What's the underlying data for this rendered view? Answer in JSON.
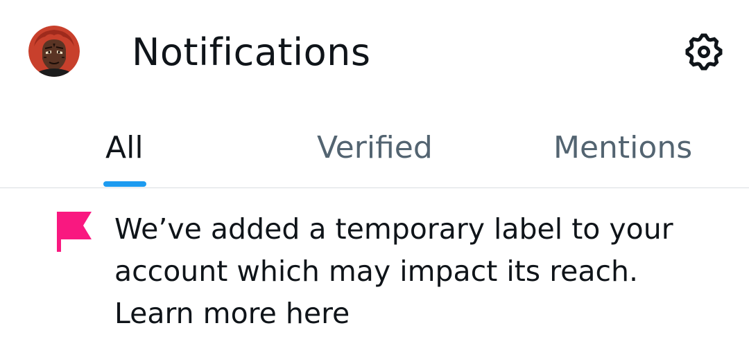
{
  "header": {
    "title": "Notifications",
    "avatar_icon": "profile-avatar",
    "settings_icon": "gear-icon"
  },
  "tabs": [
    {
      "label": "All",
      "active": true
    },
    {
      "label": "Verified",
      "active": false
    },
    {
      "label": "Mentions",
      "active": false
    }
  ],
  "notice": {
    "icon": "flag-icon",
    "icon_color": "#f91880",
    "message": "We’ve added a temporary label to your account which may impact its reach.",
    "link": "Learn more here"
  },
  "colors": {
    "accent": "#1d9bf0",
    "text_primary": "#0f1419",
    "text_secondary": "#536471",
    "divider": "#d9dee2"
  }
}
